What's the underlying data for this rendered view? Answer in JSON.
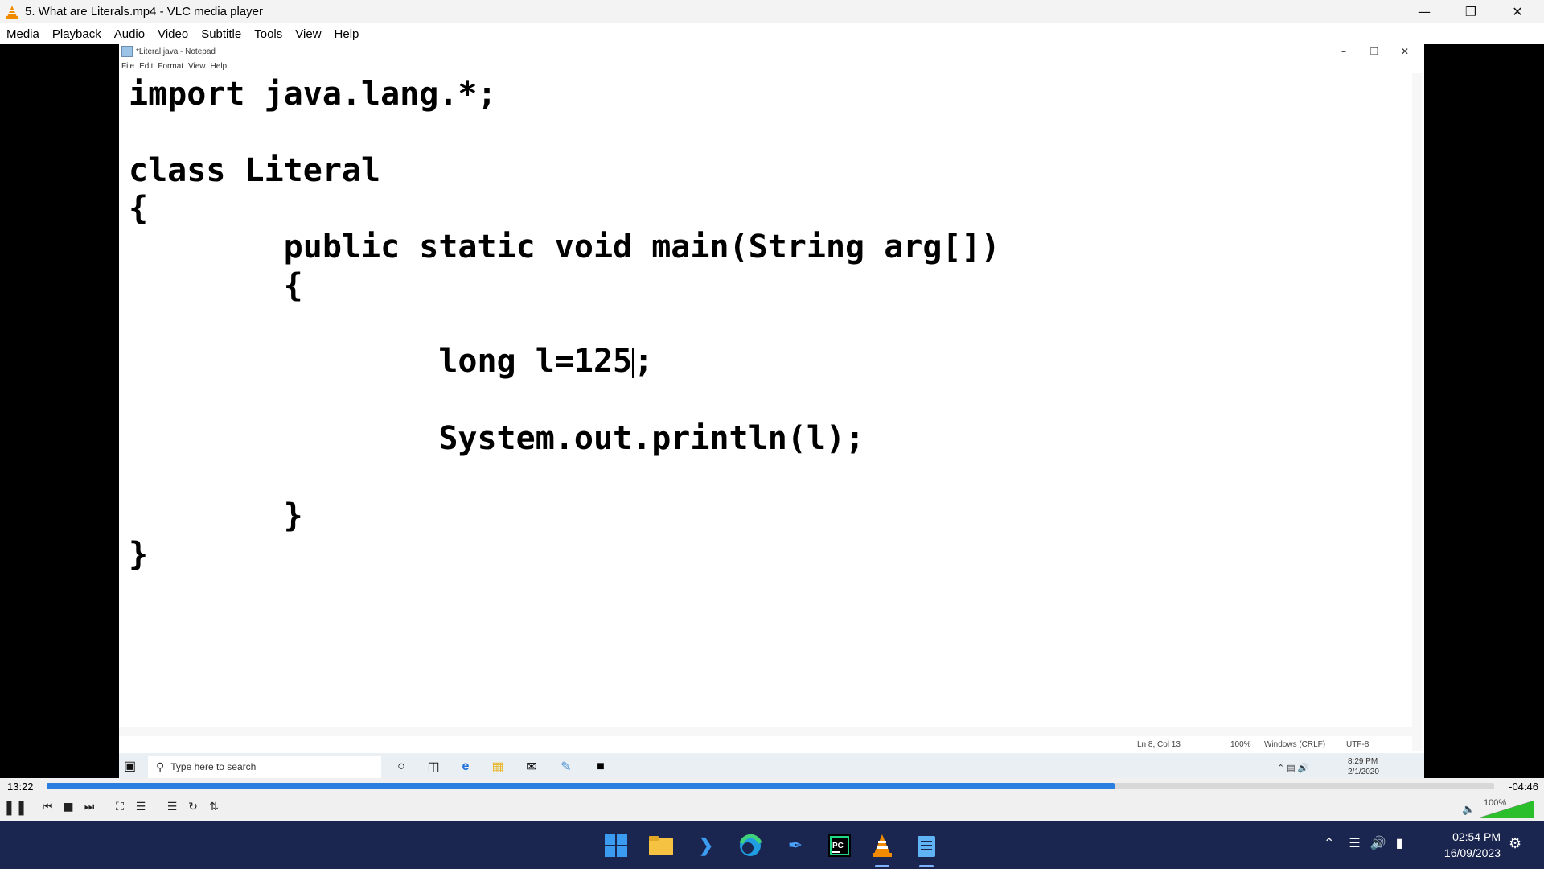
{
  "vlc": {
    "title": "5. What are Literals.mp4 - VLC media player",
    "menu": [
      "Media",
      "Playback",
      "Audio",
      "Video",
      "Subtitle",
      "Tools",
      "View",
      "Help"
    ],
    "elapsed": "13:22",
    "remaining": "-04:46",
    "progress": 0.738,
    "volume": "100%"
  },
  "notepad": {
    "title": "*Literal.java - Notepad",
    "menu": [
      "File",
      "Edit",
      "Format",
      "View",
      "Help"
    ],
    "code": [
      "import java.lang.*;",
      "",
      "class Literal",
      "{",
      "        public static void main(String arg[])",
      "        {",
      "",
      "                long l=125",
      "",
      "                System.out.println(l);",
      "",
      "        }",
      "}"
    ],
    "code_cursor_suffix": ";",
    "status": {
      "position": "Ln 8, Col 13",
      "zoom": "100%",
      "line_ending": "Windows (CRLF)",
      "encoding": "UTF-8"
    }
  },
  "win10": {
    "search_placeholder": "Type here to search",
    "time": "8:29 PM",
    "date": "2/1/2020"
  },
  "win11": {
    "time": "02:54 PM",
    "date": "16/09/2023",
    "apps": [
      "start-icon",
      "file-explorer-icon",
      "vscode-icon",
      "edge-icon",
      "pen-icon",
      "pycharm-icon",
      "vlc-icon",
      "notepad-icon"
    ]
  },
  "colors": {
    "seek_fill": "#2a7ee0",
    "taskbar": "#1b2650",
    "volume": "#2bbf2b"
  }
}
